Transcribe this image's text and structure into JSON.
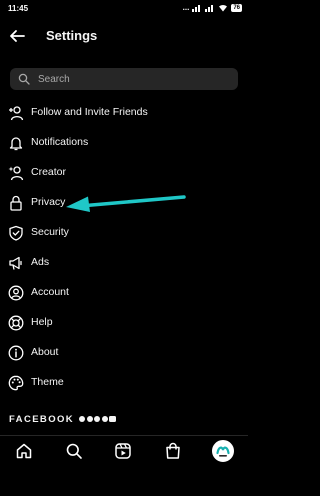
{
  "status_bar": {
    "time": "11:45",
    "signal": "...",
    "battery": "76"
  },
  "header": {
    "title": "Settings"
  },
  "search": {
    "placeholder": "Search"
  },
  "menu": {
    "items": [
      {
        "label": "Follow and Invite Friends",
        "icon": "add-person-icon"
      },
      {
        "label": "Notifications",
        "icon": "bell-icon"
      },
      {
        "label": "Creator",
        "icon": "creator-icon"
      },
      {
        "label": "Privacy",
        "icon": "lock-icon"
      },
      {
        "label": "Security",
        "icon": "shield-check-icon"
      },
      {
        "label": "Ads",
        "icon": "megaphone-icon"
      },
      {
        "label": "Account",
        "icon": "account-circle-icon"
      },
      {
        "label": "Help",
        "icon": "lifebuoy-icon"
      },
      {
        "label": "About",
        "icon": "info-icon"
      },
      {
        "label": "Theme",
        "icon": "palette-icon"
      }
    ]
  },
  "annotation": {
    "arrow_color": "#1fc7c7"
  },
  "footer": {
    "brand": "FACEBOOK"
  },
  "bottom_nav": {
    "items": [
      "home-icon",
      "search-icon",
      "reels-icon",
      "shop-icon",
      "profile-avatar"
    ]
  },
  "colors": {
    "background": "#000000",
    "text": "#f5f5f5",
    "search_bg": "#262626",
    "arrow": "#1fc7c7"
  }
}
